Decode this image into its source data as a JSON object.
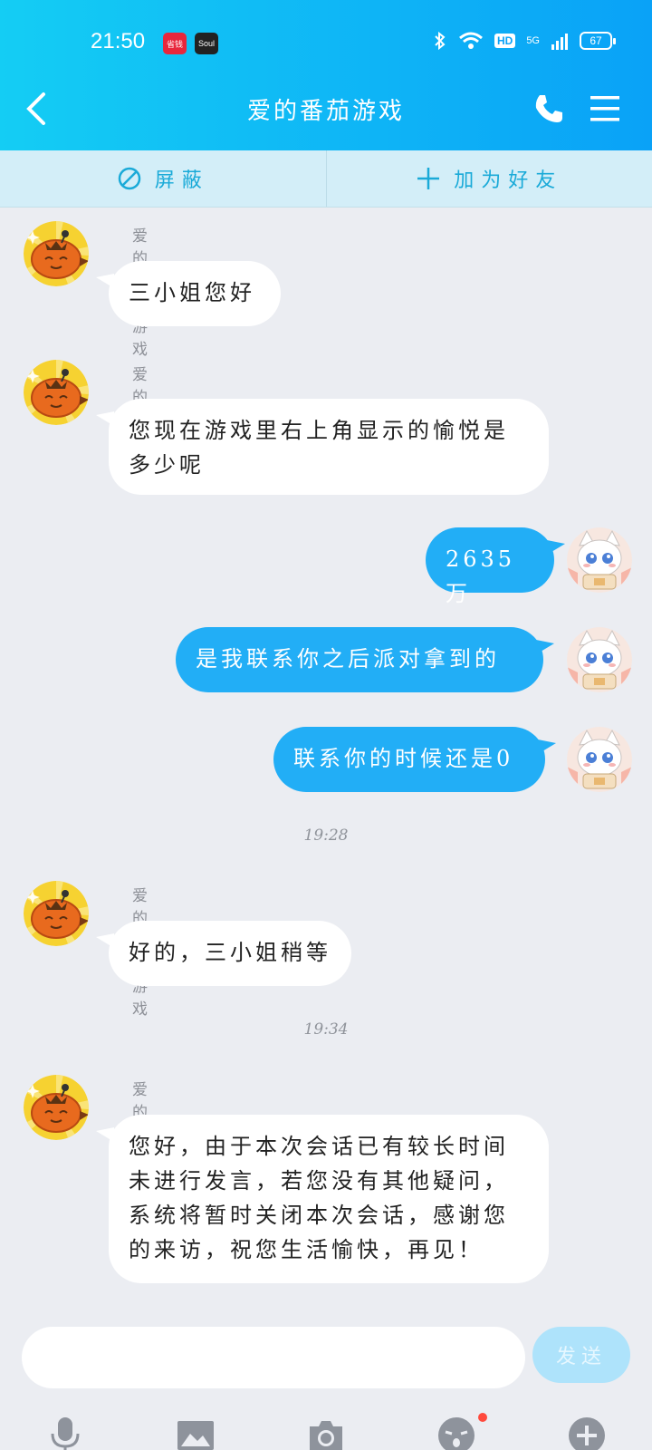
{
  "status_bar": {
    "time": "21:50",
    "app_badge_1": "省钱",
    "app_badge_2": "Soul",
    "hd": "HD",
    "network": "5G",
    "battery": "67"
  },
  "header": {
    "title": "爱的番茄游戏"
  },
  "actions": {
    "block_label": "屏蔽",
    "add_friend_label": "加为好友"
  },
  "messages": [
    {
      "sender": "爱的番茄游戏",
      "direction": "in",
      "text": "三小姐您好"
    },
    {
      "sender": "爱的番茄游戏",
      "direction": "in",
      "text": "您现在游戏里右上角显示的愉悦是多少呢"
    },
    {
      "direction": "out",
      "text": "2635万"
    },
    {
      "direction": "out",
      "text": "是我联系你之后派对拿到的"
    },
    {
      "direction": "out",
      "text": "联系你的时候还是0"
    },
    {
      "type": "timestamp",
      "text": "19:28"
    },
    {
      "sender": "爱的番茄游戏",
      "direction": "in",
      "text": "好的，三小姐稍等"
    },
    {
      "type": "timestamp",
      "text": "19:34"
    },
    {
      "sender": "爱的番茄游戏",
      "direction": "in",
      "text": "您好，由于本次会话已有较长时间未进行发言，若您没有其他疑问，系统将暂时关闭本次会话，感谢您的来访，祝您生活愉快，再见！"
    }
  ],
  "input": {
    "value": "",
    "send_label": "发送"
  },
  "toolbar": [
    "microphone-icon",
    "image-icon",
    "camera-icon",
    "emoji-icon",
    "plus-icon"
  ],
  "colors": {
    "header_start": "#14cdf4",
    "header_end": "#0aa2f7",
    "bubble_out": "#22aef6",
    "bubble_in": "#ffffff",
    "background": "#ebedf2"
  }
}
